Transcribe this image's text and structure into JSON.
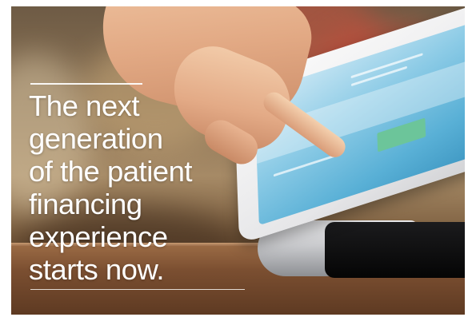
{
  "headline": {
    "lines": [
      "The next",
      "generation",
      "of the patient",
      "financing",
      "experience",
      "starts now."
    ]
  },
  "colors": {
    "headline_text": "#ffffff",
    "screen_blue": "#59b0d6",
    "counter_wood": "#7b4f31"
  }
}
